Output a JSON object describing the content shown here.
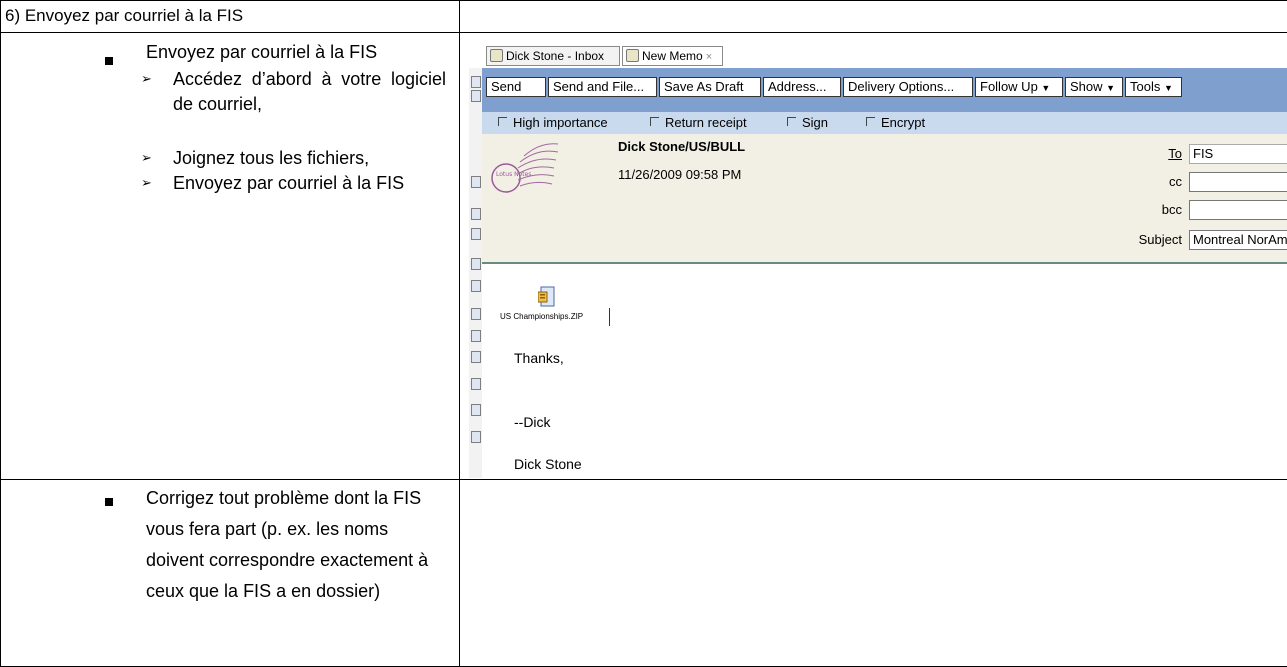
{
  "doc": {
    "heading": "6) Envoyez par courriel à la FIS",
    "bullet1": "Envoyez par courriel à la FIS",
    "sub1": "Accédez d’abord à votre logiciel de courriel,",
    "sub2": "Joignez tous les fichiers,",
    "sub3": "Envoyez par courriel à la FIS",
    "bullet2": "Corrigez tout problème dont la FIS vous fera part (p. ex. les noms doivent correspondre exactement à ceux que la FIS a en dossier)"
  },
  "email": {
    "tabs": [
      {
        "label": "Dick Stone - Inbox"
      },
      {
        "label": "New Memo"
      }
    ],
    "toolbar": {
      "send": "Send",
      "send_and_file": "Send and File...",
      "save_as_draft": "Save As Draft",
      "address": "Address...",
      "delivery_options": "Delivery Options...",
      "follow_up": "Follow Up",
      "show": "Show",
      "tools": "Tools"
    },
    "options": {
      "high_importance": "High importance",
      "return_receipt": "Return receipt",
      "sign": "Sign",
      "encrypt": "Encrypt"
    },
    "stamp_text": "Lotus Notes",
    "sender": "Dick Stone/US/BULL",
    "date": "11/26/2009 09:58 PM",
    "fields": {
      "to_label": "To",
      "to_value": "FIS",
      "cc_label": "cc",
      "cc_value": "",
      "bcc_label": "bcc",
      "bcc_value": "",
      "subject_label": "Subject",
      "subject_value": "Montreal NorAm"
    },
    "attachment": "US Championships.ZIP",
    "body": {
      "line1": "Thanks,",
      "line2": "--Dick",
      "line3": "Dick Stone"
    }
  }
}
